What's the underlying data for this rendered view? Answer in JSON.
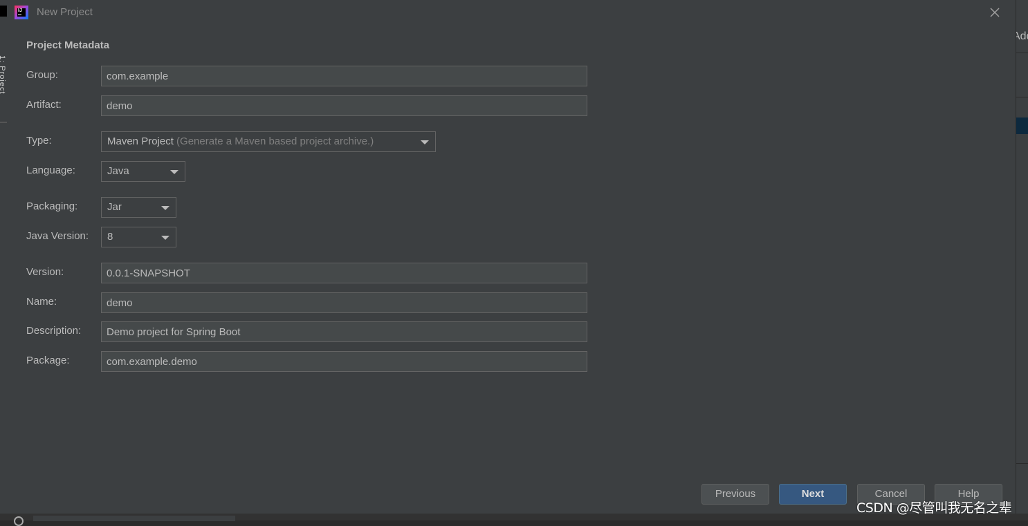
{
  "window": {
    "title": "New Project",
    "app_icon": "intellij-idea-icon"
  },
  "ide_background": {
    "left_tab_label": "1: Project",
    "right_partial_text": "Add"
  },
  "form": {
    "section_title": "Project Metadata",
    "group": {
      "label": "Group:",
      "value": "com.example"
    },
    "artifact": {
      "label": "Artifact:",
      "value": "demo"
    },
    "type": {
      "label": "Type:",
      "value": "Maven Project",
      "hint": "(Generate a Maven based project archive.)"
    },
    "language": {
      "label": "Language:",
      "value": "Java"
    },
    "packaging": {
      "label": "Packaging:",
      "value": "Jar"
    },
    "java_version": {
      "label": "Java Version:",
      "value": "8"
    },
    "version": {
      "label": "Version:",
      "value": "0.0.1-SNAPSHOT"
    },
    "name": {
      "label": "Name:",
      "value": "demo"
    },
    "description": {
      "label": "Description:",
      "value": "Demo project for Spring Boot"
    },
    "package": {
      "label": "Package:",
      "value": "com.example.demo"
    }
  },
  "buttons": {
    "previous": "Previous",
    "next": "Next",
    "cancel": "Cancel",
    "help": "Help"
  },
  "watermark": "CSDN @尽管叫我无名之辈",
  "colors": {
    "dialog_bg": "#3c3f41",
    "field_bg": "#45494a",
    "primary_button": "#365880",
    "text": "#bbbbbb"
  }
}
